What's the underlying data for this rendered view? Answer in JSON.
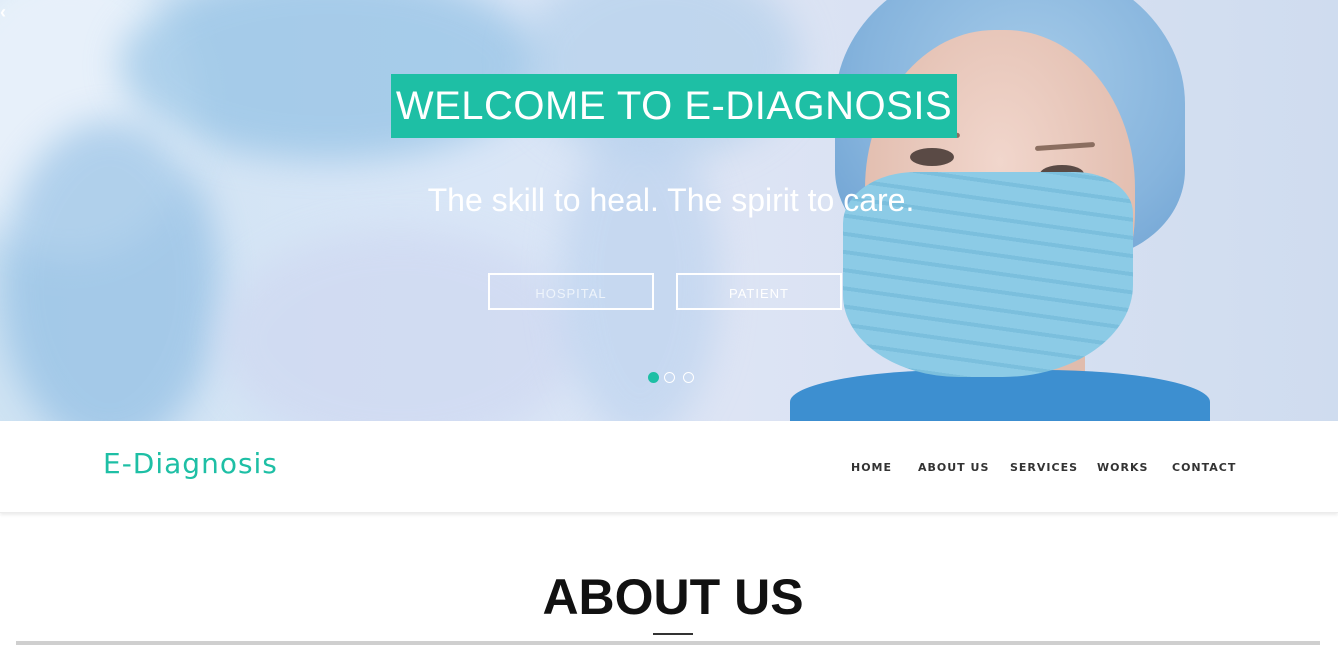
{
  "hero": {
    "back_glyph": "‹",
    "title": "WELCOME TO E-DIAGNOSIS",
    "subtitle": "The skill to heal. The spirit to care.",
    "buttons": [
      "HOSPITAL",
      "PATIENT"
    ],
    "carousel": {
      "slides": 3,
      "active_index": 0
    },
    "accent_color": "#1ebfa5"
  },
  "navbar": {
    "brand": "E-Diagnosis",
    "items": [
      "HOME",
      "ABOUT US",
      "SERVICES",
      "WORKS",
      "CONTACT"
    ]
  },
  "about": {
    "title": "ABOUT US"
  }
}
